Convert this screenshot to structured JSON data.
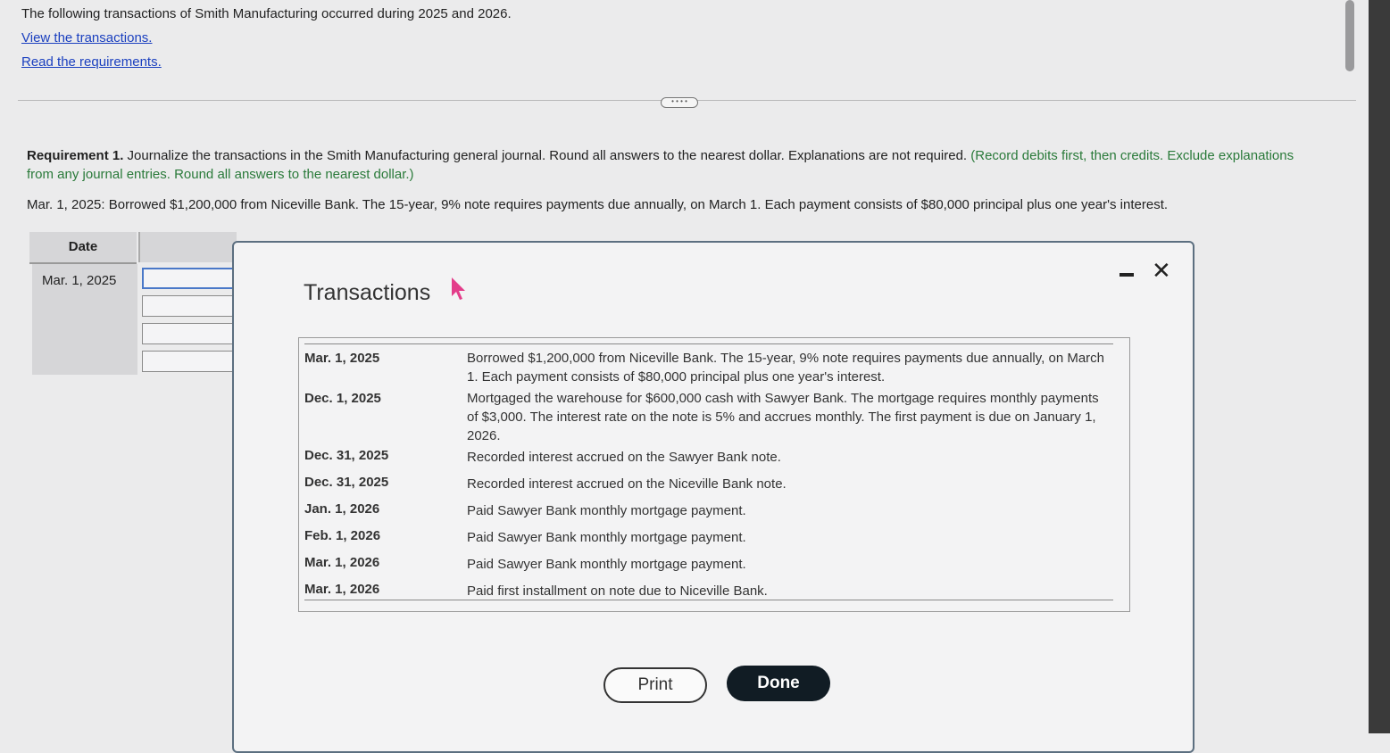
{
  "intro": {
    "text": "The following transactions of Smith Manufacturing occurred during 2025 and 2026.",
    "view_link": "View the transactions.",
    "read_link": "Read the requirements."
  },
  "expander_label": "• • • •",
  "requirement": {
    "label": "Requirement 1.",
    "text": " Journalize the transactions in the Smith Manufacturing general journal. Round all answers to the nearest dollar. Explanations are not required. ",
    "note": "(Record debits first, then credits. Exclude explanations from any journal entries. Round all answers to the nearest dollar.)"
  },
  "borrow_line": "Mar. 1, 2025: Borrowed $1,200,000 from Niceville Bank. The 15-year, 9% note requires payments due annually, on March 1. Each payment consists of $80,000 principal plus one year's interest.",
  "journal": {
    "date_header": "Date",
    "first_date": "Mar. 1, 2025"
  },
  "modal": {
    "title": "Transactions",
    "print_label": "Print",
    "done_label": "Done",
    "rows": [
      {
        "date": "Mar. 1, 2025",
        "desc": "Borrowed $1,200,000 from Niceville Bank. The 15-year, 9% note requires payments due annually, on March 1. Each payment consists of $80,000 principal plus one year's interest."
      },
      {
        "date": "Dec. 1, 2025",
        "desc": "Mortgaged the warehouse for $600,000 cash with Sawyer Bank. The mortgage requires monthly payments of $3,000. The interest rate on the note is 5% and accrues monthly. The first payment is due on January 1, 2026."
      },
      {
        "date": "Dec. 31, 2025",
        "desc": "Recorded interest accrued on the Sawyer Bank note."
      },
      {
        "date": "Dec. 31, 2025",
        "desc": "Recorded interest accrued on the Niceville Bank note."
      },
      {
        "date": "Jan. 1, 2026",
        "desc": "Paid Sawyer Bank monthly mortgage payment."
      },
      {
        "date": "Feb. 1, 2026",
        "desc": "Paid Sawyer Bank monthly mortgage payment."
      },
      {
        "date": "Mar. 1, 2026",
        "desc": "Paid Sawyer Bank monthly mortgage payment."
      },
      {
        "date": "Mar. 1, 2026",
        "desc": "Paid first installment on note due to Niceville Bank."
      }
    ]
  }
}
